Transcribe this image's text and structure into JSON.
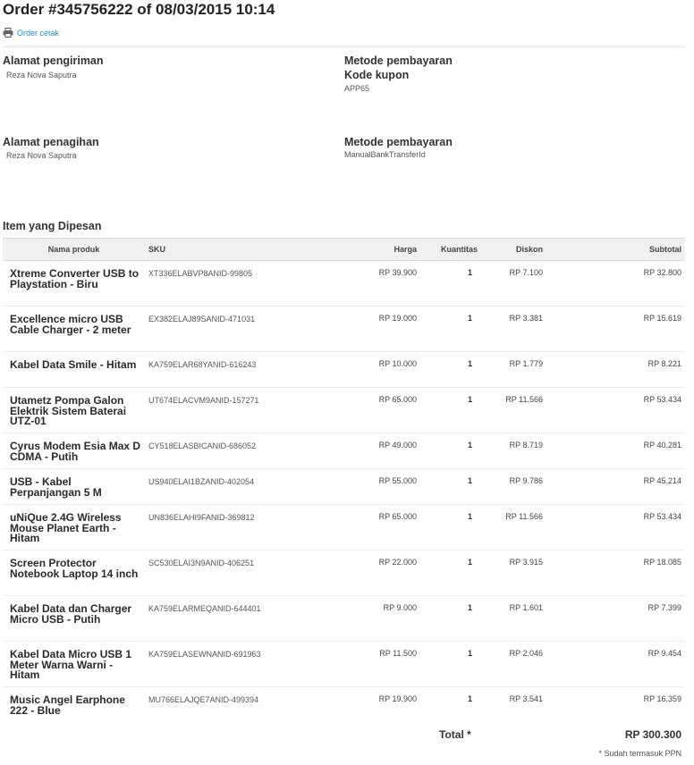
{
  "order": {
    "title": "Order #345756222 of 08/03/2015 10:14"
  },
  "print": {
    "label": "Order cetak",
    "icon": "printer-icon"
  },
  "shipping": {
    "address_heading": "Alamat pengiriman",
    "address_name": "Reza Nova Saputra",
    "method_heading": "Metode pembayaran",
    "coupon_heading": "Kode kupon",
    "coupon_value": "APP65"
  },
  "billing": {
    "address_heading": "Alamat penagihan",
    "address_name": "Reza Nova Saputra",
    "method_heading": "Metode pembayaran",
    "method_value": "ManualBankTransferId"
  },
  "items": {
    "title": "Item yang Dipesan",
    "headers": {
      "name": "Nama produk",
      "sku": "SKU",
      "price": "Harga",
      "qty": "Kuantitas",
      "discount": "Diskon",
      "subtotal": "Subtotal"
    },
    "rows": [
      {
        "name": "Xtreme Converter USB to Playstation - Biru",
        "sku": "XT336ELABVP8ANID-99805",
        "price": "RP 39.900",
        "qty": "1",
        "discount": "RP 7.100",
        "subtotal": "RP 32.800"
      },
      {
        "name": "Excellence micro USB Cable Charger - 2 meter",
        "sku": "EX382ELAJ89SANID-471031",
        "price": "RP 19.000",
        "qty": "1",
        "discount": "RP 3.381",
        "subtotal": "RP 15.619"
      },
      {
        "name": "Kabel Data Smile - Hitam",
        "sku": "KA759ELAR68YANID-616243",
        "price": "RP 10.000",
        "qty": "1",
        "discount": "RP 1.779",
        "subtotal": "RP 8.221"
      },
      {
        "name": "Utametz Pompa Galon Elektrik Sistem Baterai UTZ-01",
        "sku": "UT674ELACVM9ANID-157271",
        "price": "RP 65.000",
        "qty": "1",
        "discount": "RP 11.566",
        "subtotal": "RP 53.434"
      },
      {
        "name": "Cyrus Modem Esia Max D CDMA - Putih",
        "sku": "CY518ELASBICANID-686052",
        "price": "RP 49.000",
        "qty": "1",
        "discount": "RP 8.719",
        "subtotal": "RP 40.281"
      },
      {
        "name": "USB - Kabel Perpanjangan 5 M",
        "sku": "US940ELAI1BZANID-402054",
        "price": "RP 55.000",
        "qty": "1",
        "discount": "RP 9.786",
        "subtotal": "RP 45.214"
      },
      {
        "name": "uNiQue 2.4G Wireless Mouse Planet Earth - Hitam",
        "sku": "UN836ELAHI9FANID-369812",
        "price": "RP 65.000",
        "qty": "1",
        "discount": "RP 11.566",
        "subtotal": "RP 53.434"
      },
      {
        "name": "Screen Protector Notebook Laptop 14 inch",
        "sku": "SC530ELAI3N9ANID-406251",
        "price": "RP 22.000",
        "qty": "1",
        "discount": "RP 3.915",
        "subtotal": "RP 18.085"
      },
      {
        "name": "Kabel Data dan Charger Micro USB - Putih",
        "sku": "KA759ELARMEQANID-644401",
        "price": "RP 9.000",
        "qty": "1",
        "discount": "RP 1.601",
        "subtotal": "RP 7.399"
      },
      {
        "name": "Kabel Data Micro USB 1 Meter Warna Warni - Hitam",
        "sku": "KA759ELASEWNANID-691963",
        "price": "RP 11.500",
        "qty": "1",
        "discount": "RP 2.046",
        "subtotal": "RP 9.454"
      },
      {
        "name": "Music Angel Earphone 222 - Blue",
        "sku": "MU766ELAJQE7ANID-499394",
        "price": "RP 19.900",
        "qty": "1",
        "discount": "RP 3.541",
        "subtotal": "RP 16.359"
      }
    ]
  },
  "totals": {
    "label": "Total *",
    "value": "RP 300.300",
    "tax_note": "* Sudah termasuk PPN"
  },
  "colors": {
    "link": "#1a8fc4",
    "header_bg": "#f0f0f0",
    "text": "#333333"
  }
}
